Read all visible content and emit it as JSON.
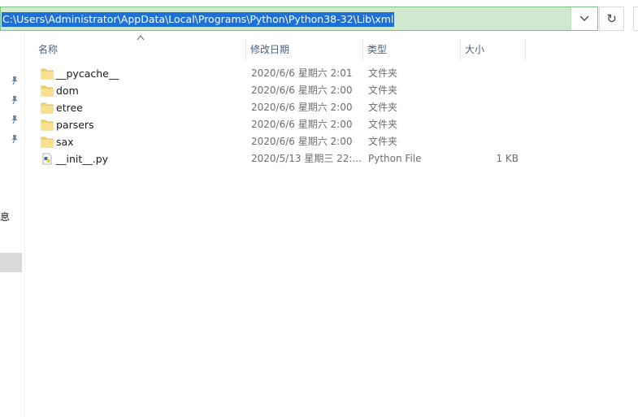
{
  "address_bar": {
    "path": "C:\\Users\\Administrator\\AppData\\Local\\Programs\\Python\\Python38-32\\Lib\\xml",
    "dropdown_icon": "chevron-down-icon",
    "refresh_icon": "refresh-icon",
    "refresh_glyph": "↻"
  },
  "nav_pane": {
    "partial_label": "息"
  },
  "columns": [
    {
      "label": "名称"
    },
    {
      "label": "修改日期"
    },
    {
      "label": "类型"
    },
    {
      "label": "大小"
    }
  ],
  "files": [
    {
      "name": "__pycache__",
      "date": "2020/6/6 星期六 2:01",
      "type": "文件夹",
      "size": "",
      "icon": "folder-icon"
    },
    {
      "name": "dom",
      "date": "2020/6/6 星期六 2:00",
      "type": "文件夹",
      "size": "",
      "icon": "folder-icon"
    },
    {
      "name": "etree",
      "date": "2020/6/6 星期六 2:00",
      "type": "文件夹",
      "size": "",
      "icon": "folder-icon"
    },
    {
      "name": "parsers",
      "date": "2020/6/6 星期六 2:00",
      "type": "文件夹",
      "size": "",
      "icon": "folder-icon"
    },
    {
      "name": "sax",
      "date": "2020/6/6 星期六 2:00",
      "type": "文件夹",
      "size": "",
      "icon": "folder-icon"
    },
    {
      "name": "__init__.py",
      "date": "2020/5/13 星期三 22:...",
      "type": "Python File",
      "size": "1 KB",
      "icon": "python-file-icon"
    }
  ],
  "colors": {
    "address_selection": "#1e6fd6",
    "address_background": "#cfe8cf",
    "header_text": "#4c607a",
    "folder_yellow": "#f5d36b"
  }
}
